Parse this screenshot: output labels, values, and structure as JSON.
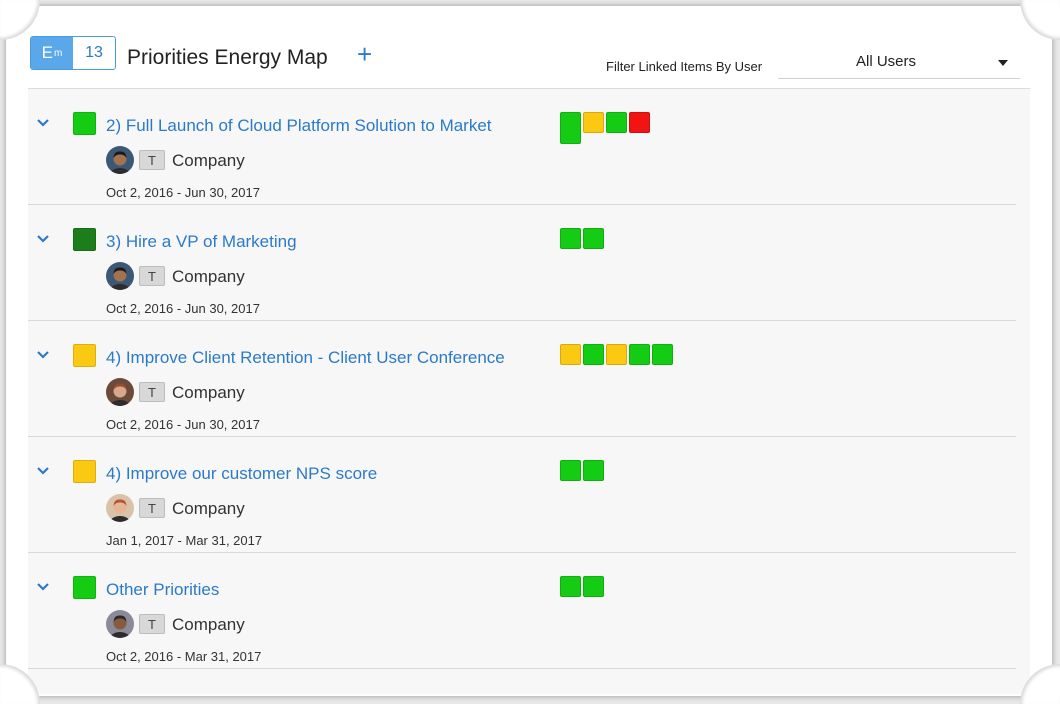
{
  "header": {
    "badge_em": "E",
    "badge_em_sup": "m",
    "badge_count": "13",
    "title": "Priorities Energy Map",
    "add_label": "+",
    "filter_label": "Filter Linked Items By User",
    "filter_value": "All Users"
  },
  "colors": {
    "green": "#14cc14",
    "dark_green": "#1b7d1b",
    "yellow": "#fbc812",
    "red": "#f21414",
    "link": "#2b7ac9"
  },
  "rows": [
    {
      "status": "green",
      "title": "2) Full Launch of Cloud Platform Solution to Market",
      "tag": "T",
      "owner": "Company",
      "dates": "Oct 2, 2016 - Jun 30, 2017",
      "avatar": "avatar-man-dark-hair",
      "energy": [
        "green",
        "yellow",
        "green",
        "red"
      ]
    },
    {
      "status": "dark_green",
      "title": "3) Hire a VP of Marketing",
      "tag": "T",
      "owner": "Company",
      "dates": "Oct 2, 2016 - Jun 30, 2017",
      "avatar": "avatar-man-dark-hair",
      "energy": [
        "green",
        "green"
      ]
    },
    {
      "status": "yellow",
      "title": "4) Improve Client Retention - Client User Conference",
      "tag": "T",
      "owner": "Company",
      "dates": "Oct 2, 2016 - Jun 30, 2017",
      "avatar": "avatar-man-glasses",
      "energy": [
        "yellow",
        "green",
        "yellow",
        "green",
        "green"
      ]
    },
    {
      "status": "yellow",
      "title": "4) Improve our customer NPS score",
      "tag": "T",
      "owner": "Company",
      "dates": "Jan 1, 2017 - Mar 31, 2017",
      "avatar": "avatar-woman-red-hair",
      "energy": [
        "green",
        "green"
      ]
    },
    {
      "status": "green",
      "title": "Other Priorities",
      "tag": "T",
      "owner": "Company",
      "dates": "Oct 2, 2016 - Mar 31, 2017",
      "avatar": "avatar-man-suit",
      "energy": [
        "green",
        "green"
      ]
    }
  ]
}
